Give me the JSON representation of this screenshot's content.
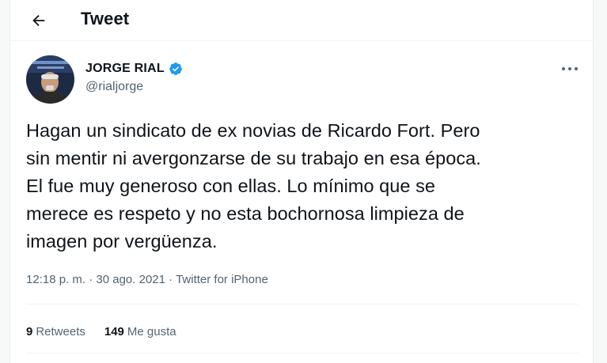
{
  "header": {
    "back_icon": "arrow-left-icon",
    "title": "Tweet"
  },
  "author": {
    "name": "JORGE RIAL",
    "handle": "@rialjorge",
    "verified_icon": "verified-badge-icon",
    "verified_color": "#1d9bf0"
  },
  "more_icon": "more-dots-icon",
  "tweet": {
    "text": "Hagan un sindicato de ex novias de Ricardo Fort. Pero\nsin mentir ni avergonzarse de su trabajo en esa época.\nEl fue muy generoso con ellas. Lo mínimo que se\nmerece es respeto y no esta bochornosa limpieza de\nimagen por vergüenza."
  },
  "meta": {
    "time": "12:18 p. m.",
    "separator": "·",
    "date": "30 ago. 2021",
    "source": "Twitter for iPhone"
  },
  "stats": {
    "retweets_count": "9",
    "retweets_label": "Retweets",
    "likes_count": "149",
    "likes_label": "Me gusta"
  },
  "colors": {
    "text_primary": "#0f1419",
    "text_secondary": "#536471",
    "divider": "#eff3f4"
  }
}
